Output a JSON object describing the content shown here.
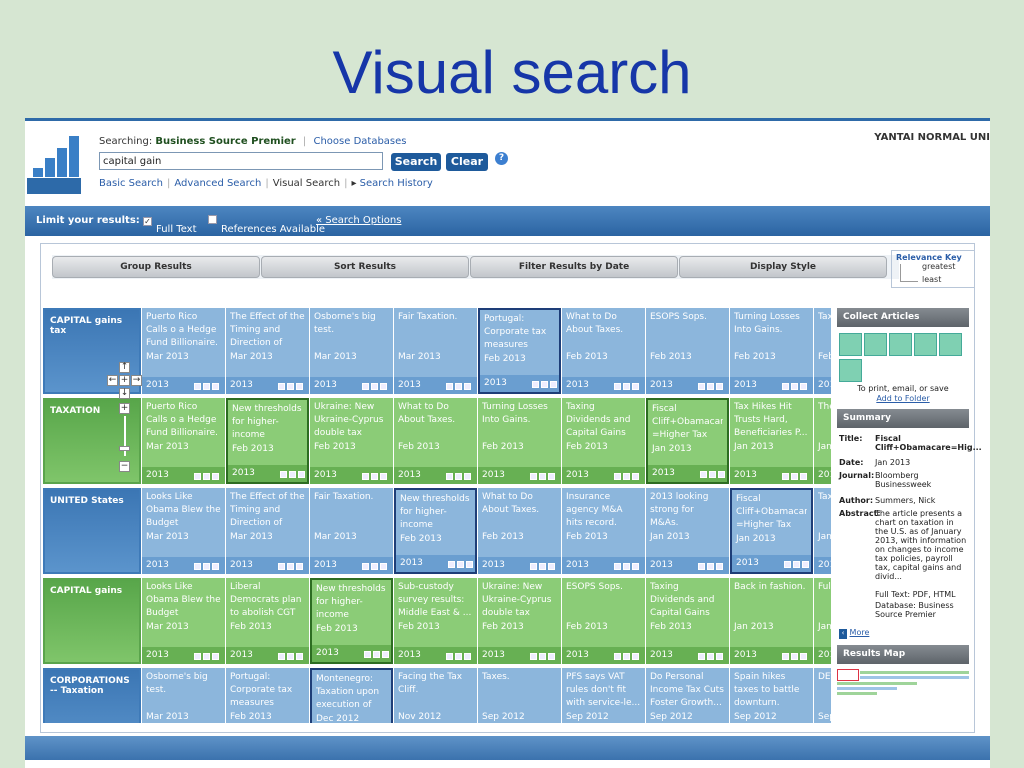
{
  "slide_title": "Visual search",
  "header": {
    "searching_label": "Searching:",
    "database": "Business Source Premier",
    "choose_databases": "Choose Databases",
    "query": "capital gain",
    "search_button": "Search",
    "clear_button": "Clear",
    "help": "?",
    "institution": "YANTAI NORMAL UNI",
    "nav": [
      "Basic Search",
      "Advanced Search",
      "Visual Search",
      "Search History"
    ]
  },
  "limit_bar": {
    "label": "Limit your results:",
    "full_text": "Full Text",
    "full_text_checked": true,
    "references": "References Available",
    "search_options": "« Search Options"
  },
  "toolbar": {
    "group_results": "Group Results",
    "sort_results": "Sort Results",
    "filter_by_date": "Filter Results by Date",
    "display_style": "Display Style"
  },
  "relevance_key": {
    "title": "Relevance Key",
    "greatest": "greatest",
    "least": "least"
  },
  "grid": {
    "rows": [
      {
        "label": "CAPITAL gains tax",
        "color": "blue",
        "cells": [
          {
            "title": "Puerto Rico Calls o a Hedge Fund Billionaire.",
            "date": "Mar 2013",
            "year": "2013"
          },
          {
            "title": "The Effect of the Timing and Direction of Ca...",
            "date": "Mar 2013",
            "year": "2013"
          },
          {
            "title": "Osborne's big test.",
            "date": "Mar 2013",
            "year": "2013"
          },
          {
            "title": "Fair Taxation.",
            "date": "Mar 2013",
            "year": "2013"
          },
          {
            "title": "Portugal: Corporate tax measures inclu...",
            "date": "Feb 2013",
            "year": "2013",
            "selected": true
          },
          {
            "title": "What to Do About Taxes.",
            "date": "Feb 2013",
            "year": "2013"
          },
          {
            "title": "ESOPS Sops.",
            "date": "Feb 2013",
            "year": "2013"
          },
          {
            "title": "Turning Losses Into Gains.",
            "date": "Feb 2013",
            "year": "2013"
          },
          {
            "title": "Tax and Inco",
            "date": "Feb",
            "year": "201"
          }
        ]
      },
      {
        "label": "TAXATION",
        "color": "green",
        "cells": [
          {
            "title": "Puerto Rico Calls o a Hedge Fund Billionaire.",
            "date": "Mar 2013",
            "year": "2013"
          },
          {
            "title": "New thresholds for higher-income individ...",
            "date": "Feb 2013",
            "year": "2013",
            "selected": true
          },
          {
            "title": "Ukraine: New Ukraine-Cyprus double tax trea...",
            "date": "Feb 2013",
            "year": "2013"
          },
          {
            "title": "What to Do About Taxes.",
            "date": "Feb 2013",
            "year": "2013"
          },
          {
            "title": "Turning Losses Into Gains.",
            "date": "Feb 2013",
            "year": "2013"
          },
          {
            "title": "Taxing Dividends and Capital Gains Income Fairly.",
            "date": "Feb 2013",
            "year": "2013"
          },
          {
            "title": "Fiscal Cliff+Obamacare =Higher Tax on...",
            "date": "Jan 2013",
            "year": "2013",
            "selected": true
          },
          {
            "title": "Tax Hikes Hit Trusts Hard, Beneficiaries P...",
            "date": "Jan 2013",
            "year": "2013"
          },
          {
            "title": "The Dea We",
            "date": "Jan",
            "year": "201"
          }
        ]
      },
      {
        "label": "UNITED States",
        "color": "blue",
        "cells": [
          {
            "title": "Looks Like Obama Blew the Budget Negotia...",
            "date": "Mar 2013",
            "year": "2013"
          },
          {
            "title": "The Effect of the Timing and Direction of Ca...",
            "date": "Mar 2013",
            "year": "2013"
          },
          {
            "title": "Fair Taxation.",
            "date": "Mar 2013",
            "year": "2013"
          },
          {
            "title": "New thresholds for higher-income individ...",
            "date": "Feb 2013",
            "year": "2013",
            "selected": true
          },
          {
            "title": "What to Do About Taxes.",
            "date": "Feb 2013",
            "year": "2013"
          },
          {
            "title": "Insurance agency M&A hits record.",
            "date": "Feb 2013",
            "year": "2013"
          },
          {
            "title": "2013 looking strong for M&As.",
            "date": "Jan 2013",
            "year": "2013"
          },
          {
            "title": "Fiscal Cliff+Obamacare =Higher Tax on...",
            "date": "Jan 2013",
            "year": "2013",
            "selected": true
          },
          {
            "title": "Tax Tru Ber",
            "date": "Jan",
            "year": "201"
          }
        ]
      },
      {
        "label": "CAPITAL gains",
        "color": "green",
        "cells": [
          {
            "title": "Looks Like Obama Blew the Budget Negotia...",
            "date": "Mar 2013",
            "year": "2013"
          },
          {
            "title": "Liberal Democrats plan to abolish CGT ...",
            "date": "Feb 2013",
            "year": "2013"
          },
          {
            "title": "New thresholds for higher-income individ...",
            "date": "Feb 2013",
            "year": "2013",
            "selected": true
          },
          {
            "title": "Sub-custody survey results: Middle East & ...",
            "date": "Feb 2013",
            "year": "2013"
          },
          {
            "title": "Ukraine: New Ukraine-Cyprus double tax trea...",
            "date": "Feb 2013",
            "year": "2013"
          },
          {
            "title": "ESOPS Sops.",
            "date": "Feb 2013",
            "year": "2013"
          },
          {
            "title": "Taxing Dividends and Capital Gains Income Fairly.",
            "date": "Feb 2013",
            "year": "2013"
          },
          {
            "title": "Back in fashion.",
            "date": "Jan 2013",
            "year": "2013"
          },
          {
            "title": "Fult Ove Inte",
            "date": "Jan",
            "year": "201"
          }
        ]
      },
      {
        "label": "CORPORATIONS -- Taxation",
        "color": "blue",
        "cells": [
          {
            "title": "Osborne's big test.",
            "date": "Mar 2013",
            "year": ""
          },
          {
            "title": "Portugal: Corporate tax measures inclu...",
            "date": "Feb 2013",
            "year": ""
          },
          {
            "title": "Montenegro: Taxation upon execution of v...",
            "date": "Dec 2012",
            "year": "",
            "selected": true
          },
          {
            "title": "Facing the Tax Cliff.",
            "date": "Nov 2012",
            "year": ""
          },
          {
            "title": "Taxes.",
            "date": "Sep 2012",
            "year": ""
          },
          {
            "title": "PFS says VAT rules don't fit with service-le...",
            "date": "Sep 2012",
            "year": ""
          },
          {
            "title": "Do Personal Income Tax Cuts Foster Growth...",
            "date": "Sep 2012",
            "year": ""
          },
          {
            "title": "Spain hikes taxes to battle downturn.",
            "date": "Sep 2012",
            "year": ""
          },
          {
            "title": "DET TAX COI",
            "date": "Sep",
            "year": ""
          }
        ]
      }
    ]
  },
  "sidebar": {
    "collect_title": "Collect Articles",
    "collect_note": "To print, email, or save",
    "add_to_folder": "Add to Folder",
    "summary_title": "Summary",
    "summary": [
      {
        "k": "Title:",
        "v": "Fiscal Cliff+Obamacare=Hig..."
      },
      {
        "k": "Date:",
        "v": "Jan 2013"
      },
      {
        "k": "Journal:",
        "v": "Bloomberg Businessweek"
      },
      {
        "k": "Author:",
        "v": "Summers, Nick"
      },
      {
        "k": "Abstract:",
        "v": "The article presents a chart on taxation in the U.S. as of January 2013, with information on changes to income tax policies, payroll tax, capital gains and divid..."
      }
    ],
    "fulltext": "Full Text: PDF, HTML",
    "database": "Database: Business Source Premier",
    "more": "More",
    "results_map_title": "Results Map"
  }
}
